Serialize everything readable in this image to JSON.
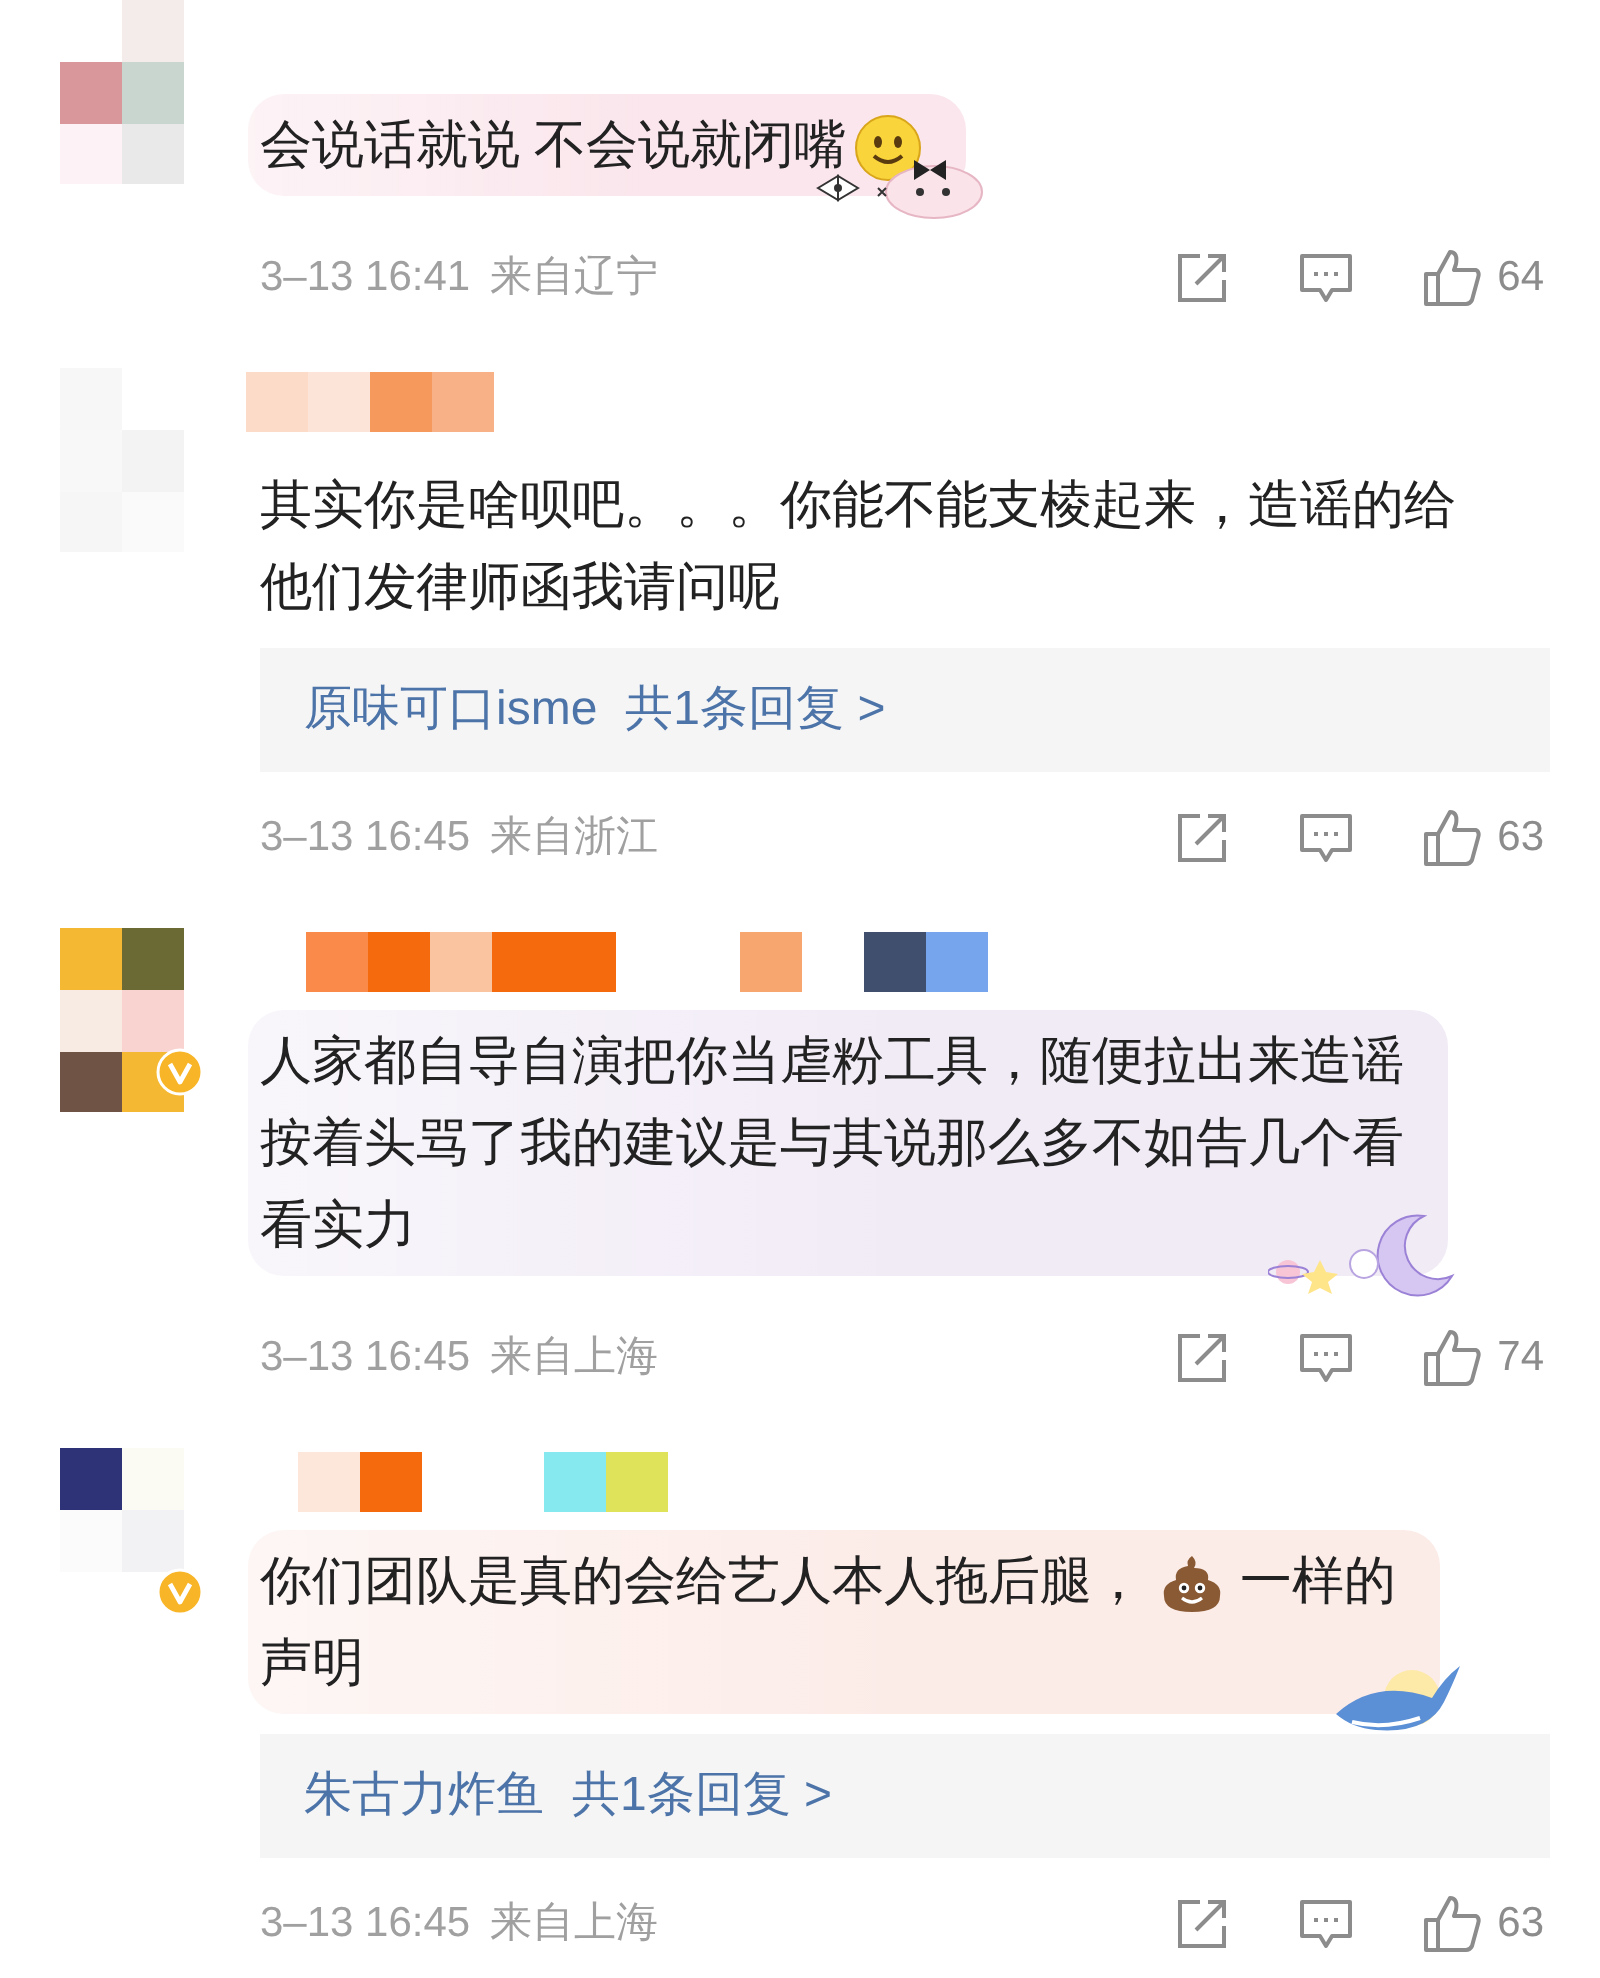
{
  "comments": [
    {
      "masked_name": false,
      "verified": false,
      "highlighted": true,
      "segments": [
        {
          "kind": "text",
          "text": "会说话就说 不会说就闭嘴"
        },
        {
          "kind": "smiley"
        }
      ],
      "meta": {
        "time": "3–13 16:41",
        "location": "来自辽宁",
        "likes": "64"
      }
    },
    {
      "masked_name": true,
      "verified": false,
      "highlighted": false,
      "segments": [
        {
          "kind": "text",
          "text": "其实你是啥呗吧。。。你能不能支棱起来，造谣的给"
        },
        {
          "kind": "break"
        },
        {
          "kind": "text",
          "text": "他们发律师函我请问呢"
        }
      ],
      "reply": {
        "author": "原味可口isme",
        "count": "共1条回复 >"
      },
      "meta": {
        "time": "3–13 16:45",
        "location": "来自浙江",
        "likes": "63"
      }
    },
    {
      "masked_name": true,
      "verified": true,
      "highlighted": true,
      "segments": [
        {
          "kind": "text",
          "text": "人家都自导自演把你当虐粉工具，随便拉出来造谣"
        },
        {
          "kind": "break"
        },
        {
          "kind": "text",
          "text": "按着头骂了我的建议是与其说那么多不如告几个看"
        },
        {
          "kind": "break"
        },
        {
          "kind": "text",
          "text": "看实力"
        }
      ],
      "meta": {
        "time": "3–13 16:45",
        "location": "来自上海",
        "likes": "74"
      }
    },
    {
      "masked_name": true,
      "verified": true,
      "highlighted": true,
      "segments": [
        {
          "kind": "text",
          "text": "你们团队是真的会给艺人本人拖后腿，"
        },
        {
          "kind": "poop"
        },
        {
          "kind": "text",
          "text": "一样的"
        },
        {
          "kind": "break"
        },
        {
          "kind": "text",
          "text": "声明"
        }
      ],
      "reply": {
        "author": "朱古力炸鱼",
        "count": "共1条回复 >"
      },
      "meta": {
        "time": "3–13 16:45",
        "location": "来自上海",
        "likes": "63"
      }
    }
  ]
}
